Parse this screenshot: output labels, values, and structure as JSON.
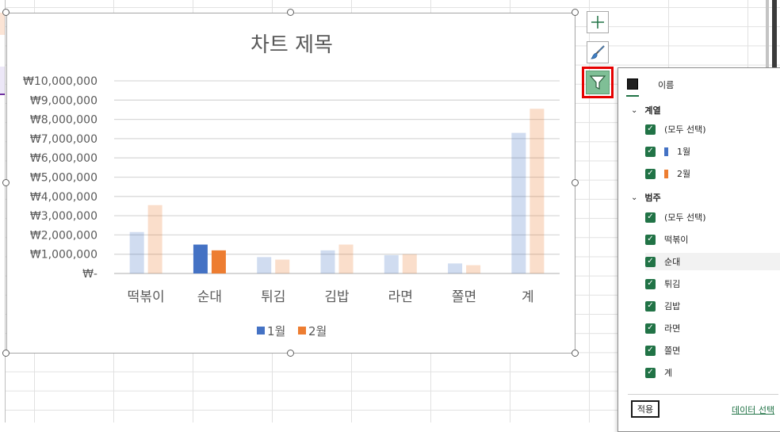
{
  "chart_data": {
    "type": "bar",
    "title": "차트 제목",
    "categories": [
      "떡볶이",
      "순대",
      "튀김",
      "김밥",
      "라면",
      "쫄면",
      "계"
    ],
    "series": [
      {
        "name": "1월",
        "color": "#4472c4",
        "values": [
          2150000,
          1500000,
          850000,
          1200000,
          950000,
          520000,
          7300000
        ]
      },
      {
        "name": "2월",
        "color": "#ed7d31",
        "values": [
          3550000,
          1200000,
          720000,
          1500000,
          1000000,
          430000,
          8550000
        ]
      }
    ],
    "highlighted_category": "순대",
    "y_ticks": [
      "₩-",
      "₩1,000,000",
      "₩2,000,000",
      "₩3,000,000",
      "₩4,000,000",
      "₩5,000,000",
      "₩6,000,000",
      "₩7,000,000",
      "₩8,000,000",
      "₩9,000,000",
      "₩10,000,000"
    ],
    "ylim": [
      0,
      10000000
    ],
    "grid": true,
    "legend_position": "bottom"
  },
  "side_buttons": {
    "elements_icon": "plus-icon",
    "styles_icon": "paintbrush-icon",
    "filter_icon": "funnel-icon"
  },
  "filter_panel": {
    "tab_name": "이름",
    "series_section": {
      "title": "계열",
      "items": [
        {
          "label": "(모두 선택)"
        },
        {
          "label": "1월",
          "color": "#4472c4"
        },
        {
          "label": "2월",
          "color": "#ed7d31"
        }
      ]
    },
    "category_section": {
      "title": "범주",
      "items": [
        {
          "label": "(모두 선택)"
        },
        {
          "label": "떡볶이"
        },
        {
          "label": "순대"
        },
        {
          "label": "튀김"
        },
        {
          "label": "김밥"
        },
        {
          "label": "라면"
        },
        {
          "label": "쫄면"
        },
        {
          "label": "계"
        }
      ]
    },
    "apply_label": "적용",
    "select_data_label": "데이터 선택"
  },
  "colors": {
    "accent": "#217346",
    "filter_highlight": "#e60000"
  }
}
